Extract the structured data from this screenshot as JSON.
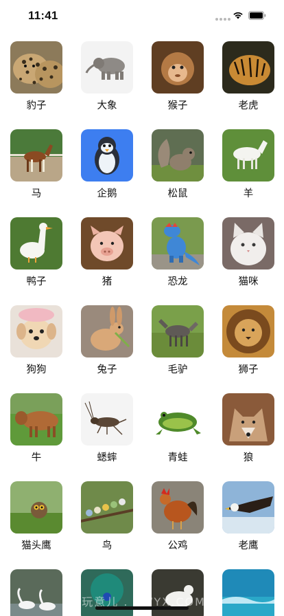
{
  "status": {
    "time": "11:41"
  },
  "animals": [
    {
      "label": "豹子",
      "icon": "leopard-image"
    },
    {
      "label": "大象",
      "icon": "elephant-image"
    },
    {
      "label": "猴子",
      "icon": "monkey-image"
    },
    {
      "label": "老虎",
      "icon": "tiger-image"
    },
    {
      "label": "马",
      "icon": "horse-image"
    },
    {
      "label": "企鹅",
      "icon": "penguin-image"
    },
    {
      "label": "松鼠",
      "icon": "squirrel-image"
    },
    {
      "label": "羊",
      "icon": "goat-image"
    },
    {
      "label": "鸭子",
      "icon": "duck-image"
    },
    {
      "label": "猪",
      "icon": "pig-image"
    },
    {
      "label": "恐龙",
      "icon": "dinosaur-image"
    },
    {
      "label": "猫咪",
      "icon": "cat-image"
    },
    {
      "label": "狗狗",
      "icon": "dog-image"
    },
    {
      "label": "兔子",
      "icon": "rabbit-image"
    },
    {
      "label": "毛驴",
      "icon": "donkey-image"
    },
    {
      "label": "狮子",
      "icon": "lion-image"
    },
    {
      "label": "牛",
      "icon": "cow-image"
    },
    {
      "label": "蟋蟀",
      "icon": "cricket-image"
    },
    {
      "label": "青蛙",
      "icon": "frog-image"
    },
    {
      "label": "狼",
      "icon": "wolf-image"
    },
    {
      "label": "猫头鹰",
      "icon": "owl-image"
    },
    {
      "label": "鸟",
      "icon": "bird-image"
    },
    {
      "label": "公鸡",
      "icon": "rooster-image"
    },
    {
      "label": "老鹰",
      "icon": "eagle-image"
    },
    {
      "label": "",
      "icon": "swan-image"
    },
    {
      "label": "",
      "icon": "peacock-image"
    },
    {
      "label": "",
      "icon": "pigeon-image"
    },
    {
      "label": "",
      "icon": "dolphin-image"
    }
  ],
  "watermark": "1 玩意儿 . 1WYX.COM"
}
